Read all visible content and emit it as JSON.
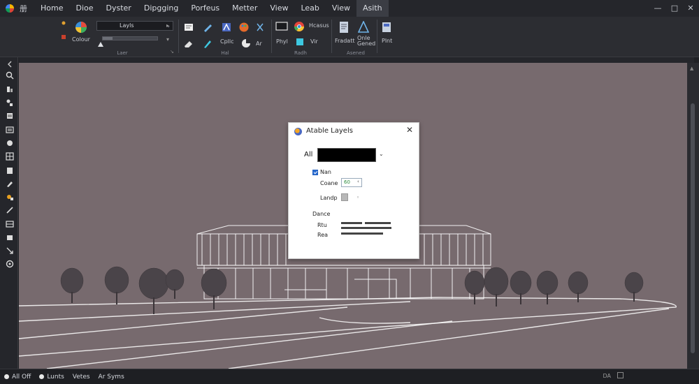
{
  "menubar": {
    "glyph": "册",
    "items": [
      "Home",
      "Dioe",
      "Dyster",
      "Dipgging",
      "Porfeus",
      "Metter",
      "View",
      "Leab",
      "View",
      "Asith"
    ],
    "active_index": 9,
    "window_controls": {
      "minimize": "—",
      "maximize": "□",
      "close": "✕"
    }
  },
  "ribbon": {
    "layer_select_value": "Layls",
    "layer_color_label": "Colour",
    "group_labels": [
      "Laer",
      "Hal",
      "Radh",
      "Asened"
    ],
    "draw_caption": "Cpllc",
    "draw_sub": "Ar",
    "view_labels": [
      "Phyl",
      "Hcasus",
      "Vir"
    ],
    "tool_labels": [
      "Fradatt",
      "Onle Gened",
      "Plnt"
    ]
  },
  "viewport": {
    "background": "#776a6e"
  },
  "dialog": {
    "title": "Atable Layels",
    "close": "✕",
    "filter_label": "All",
    "filter_caret": "⌄",
    "checkbox_label": "Nan",
    "checkbox_checked": true,
    "color_label": "Coane",
    "color_value": "60",
    "color_spin": "‹",
    "linetype_label": "Landp",
    "linetype_value": "◦",
    "section_label": "Dance",
    "row1_label": "Rtu",
    "row2_label": "Rea"
  },
  "statusbar": {
    "items": [
      "All Off",
      "Lunts",
      "Vetes",
      "Ar Syms"
    ],
    "right_text": "DA"
  }
}
